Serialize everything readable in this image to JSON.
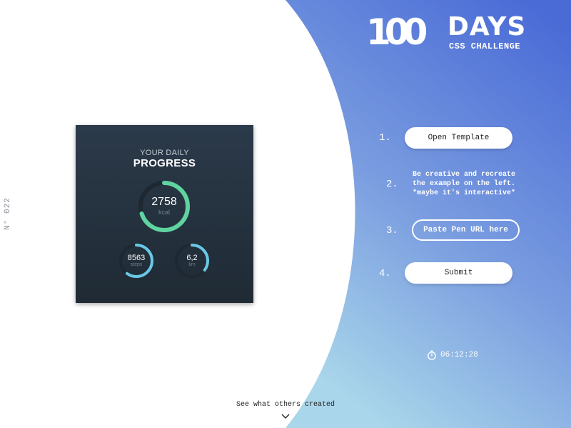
{
  "side_label": "N° 022",
  "card": {
    "subtitle": "YOUR DAILY",
    "title": "PROGRESS",
    "kcal": {
      "value": "2758",
      "unit": "kcal",
      "progress": 0.7,
      "color": "#5fd3a0"
    },
    "steps": {
      "value": "8563",
      "unit": "steps",
      "progress": 0.6,
      "color": "#6ac8e6"
    },
    "km": {
      "value": "6,2",
      "unit": "km",
      "progress": 0.35,
      "color": "#6ac8e6"
    },
    "track_color": "#1f2933"
  },
  "logo": {
    "number": "100",
    "word": "DAYS",
    "subtitle": "CSS CHALLENGE"
  },
  "steps": {
    "one": {
      "num": "1.",
      "label": "Open Template"
    },
    "two": {
      "num": "2.",
      "line1": "Be creative and recreate",
      "line2": "the example on the left.",
      "line3": "*maybe it's interactive*"
    },
    "three": {
      "num": "3.",
      "label": "Paste Pen URL here"
    },
    "four": {
      "num": "4.",
      "label": "Submit"
    }
  },
  "timer": {
    "icon": "stopwatch-icon",
    "value": "06:12:28"
  },
  "footer": {
    "link": "See what others created",
    "icon": "chevron-down-icon"
  },
  "colors": {
    "gradient_top": "#4a6fd8",
    "gradient_bottom": "#a6d3ea",
    "card_bg": "#27333f"
  }
}
